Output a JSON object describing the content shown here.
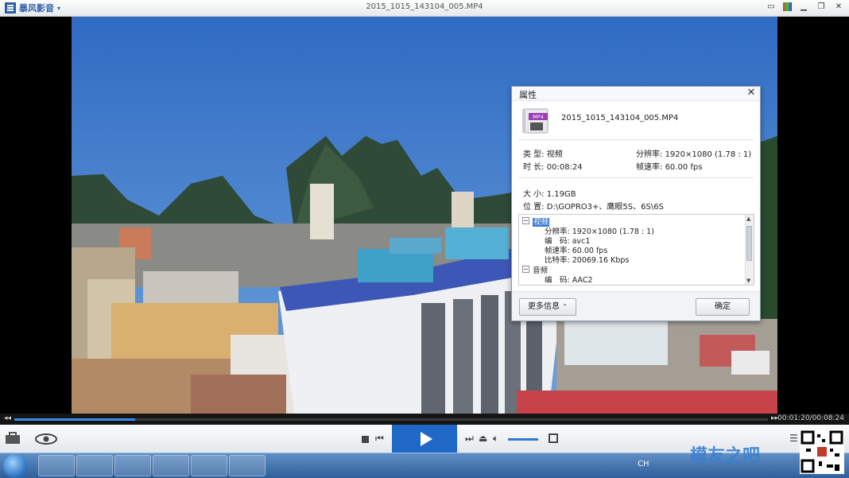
{
  "app": {
    "name": "暴风影音",
    "window_title": "2015_1015_143104_005.MP4"
  },
  "dialog": {
    "title": "属性",
    "file_name": "2015_1015_143104_005.MP4",
    "file_icon_label": "MP4",
    "type_label": "类 型:",
    "type_value": "视频",
    "duration_label": "时 长:",
    "duration_value": "00:08:24",
    "resolution_label": "分辨率:",
    "resolution_value": "1920×1080 (1.78 : 1)",
    "framerate_label": "帧速率:",
    "framerate_value": "60.00 fps",
    "size_label": "大 小:",
    "size_value": "1.19GB",
    "location_label": "位 置:",
    "location_value": "D:\\GOPRO3+、鹰眼5S、6S\\6S",
    "tree": {
      "video_header": "视频",
      "video_rows": [
        {
          "label": "分辨率:",
          "value": "1920×1080 (1.78 : 1)"
        },
        {
          "label": "编　码:",
          "value": "avc1"
        },
        {
          "label": "帧速率:",
          "value": "60.00 fps"
        },
        {
          "label": "比特率:",
          "value": "20069.16 Kbps"
        }
      ],
      "audio_header": "音频",
      "audio_rows": [
        {
          "label": "编　码:",
          "value": "AAC2"
        }
      ]
    },
    "more_info_button": "更多信息",
    "ok_button": "确定"
  },
  "player": {
    "time_display": "00:01:20/00:08:24",
    "progress_fraction": 0.16,
    "volume_fraction": 0.9
  },
  "taskbar": {
    "ime": "CH",
    "watermark": "模友之吧"
  },
  "colors": {
    "accent": "#1f68c6",
    "highlight": "#3a79d9"
  },
  "icons": [
    "toolbox-icon",
    "eye-icon",
    "stop-icon",
    "prev-icon",
    "play-icon",
    "next-icon",
    "eject-icon",
    "volume-icon",
    "fullscreen-icon",
    "playlist-icon",
    "close-icon",
    "chat-icon",
    "skin-icon",
    "minimize-icon",
    "restore-icon"
  ]
}
